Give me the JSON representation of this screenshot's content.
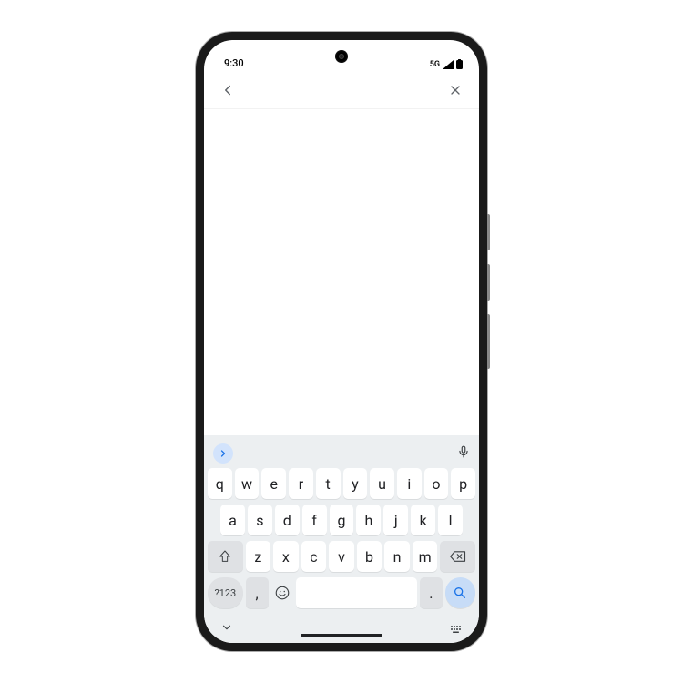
{
  "status": {
    "time": "9:30",
    "network": "5G"
  },
  "keyboard": {
    "row1": [
      "q",
      "w",
      "e",
      "r",
      "t",
      "y",
      "u",
      "i",
      "o",
      "p"
    ],
    "row2": [
      "a",
      "s",
      "d",
      "f",
      "g",
      "h",
      "j",
      "k",
      "l"
    ],
    "row3": [
      "z",
      "x",
      "c",
      "v",
      "b",
      "n",
      "m"
    ],
    "symnum_label": "?123",
    "comma": ",",
    "period": "."
  }
}
